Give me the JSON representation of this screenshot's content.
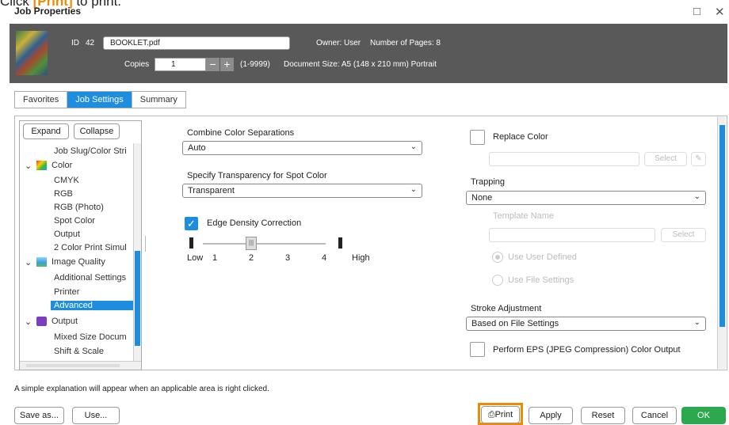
{
  "instruction": {
    "prefix": "Click ",
    "highlight": "[Print]",
    "suffix": " to print."
  },
  "window": {
    "title": "Job Properties"
  },
  "header": {
    "id_label": "ID",
    "id_value": "42",
    "file_name": "BOOKLET.pdf",
    "owner": "Owner: User",
    "pages": "Number of Pages: 8",
    "copies_label": "Copies",
    "copies_value": "1",
    "copies_range": "(1-9999)",
    "document_size": "Document Size:  A5 (148 x 210 mm) Portrait"
  },
  "tabs": [
    {
      "label": "Favorites"
    },
    {
      "label": "Job Settings"
    },
    {
      "label": "Summary"
    }
  ],
  "tree": {
    "expand": "Expand",
    "collapse": "Collapse",
    "items": [
      "Job Slug/Color Stri",
      "Color",
      "CMYK",
      "RGB",
      "RGB (Photo)",
      "Spot Color",
      "Output",
      "2 Color Print Simul",
      "Image Quality",
      "Additional Settings",
      "Printer",
      "Advanced",
      "Output",
      "Mixed Size Docum",
      "Shift & Scale"
    ]
  },
  "settings": {
    "combine_label": "Combine Color Separations",
    "combine_value": "Auto",
    "transparency_label": "Specify Transparency for Spot Color",
    "transparency_value": "Transparent",
    "edge_label": "Edge Density Correction",
    "slider_low": "Low",
    "slider_high": "High",
    "ticks": [
      "1",
      "2",
      "3",
      "4"
    ],
    "slider_value": 2,
    "replace_label": "Replace Color",
    "select_label": "Select",
    "trapping_label": "Trapping",
    "trapping_value": "None",
    "template_label": "Template Name",
    "use_user": "Use User Defined",
    "use_file": "Use File Settings",
    "stroke_label": "Stroke Adjustment",
    "stroke_value": "Based on File Settings",
    "eps_label": "Perform EPS (JPEG Compression) Color Output"
  },
  "status": "A simple explanation will appear when an applicable area is right clicked.",
  "footer": {
    "save_as": "Save as...",
    "use": "Use...",
    "print": "Print",
    "apply": "Apply",
    "reset": "Reset",
    "cancel": "Cancel",
    "ok": "OK"
  },
  "colors": {
    "accent": "#1d8de0",
    "highlight": "#f08a00",
    "ok": "#2ea84d"
  }
}
